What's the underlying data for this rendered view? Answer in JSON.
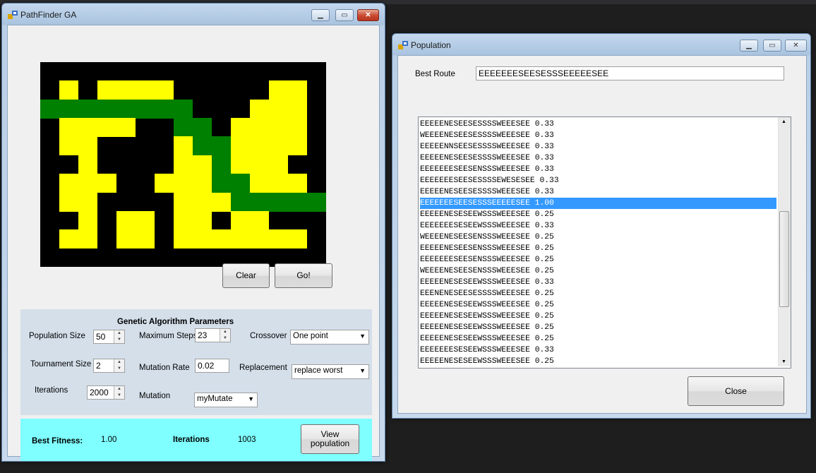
{
  "pathfinder": {
    "title": "PathFinder GA",
    "clear_label": "Clear",
    "go_label": "Go!",
    "params_heading": "Genetic Algorithm Parameters",
    "population_size_label": "Population Size",
    "population_size": "50",
    "max_steps_label": "Maximum Steps",
    "max_steps": "23",
    "crossover_label": "Crossover",
    "crossover": "One point",
    "tournament_size_label": "Tournament Size",
    "tournament_size": "2",
    "mutation_rate_label": "Mutation Rate",
    "mutation_rate": "0.02",
    "replacement_label": "Replacement",
    "replacement": "replace worst",
    "iterations_label": "Iterations",
    "iterations": "2000",
    "mutation_label": "Mutation",
    "mutation": "myMutate",
    "best_fitness_label": "Best Fitness:",
    "best_fitness": "1.00",
    "iterations_result_label": "Iterations",
    "iterations_result": "1003",
    "view_population_label": "View population"
  },
  "population": {
    "title": "Population",
    "best_route_label": "Best Route",
    "best_route": "EEEEEEESEESESSSEEEEESEE",
    "close_label": "Close",
    "rows": [
      "EEEEENESEESESSSSWEEESEE 0.33",
      "WEEEENESEESESSSSWEEESEE 0.33",
      "EEEEENNSEESESSSSWEEESEE 0.33",
      "EEEEENESEESESSSSWEEESEE 0.33",
      "EEEEEEESEESENSSSWEEESEE 0.33",
      "EEEEEEESEESESSSSEWESESEE 0.33",
      "EEEEENESEESESSSSWEEESEE 0.33",
      "EEEEEEESEESESSSEEEEESEE 1.00",
      "EEEEENESESEEWSSSWEEESEE 0.25",
      "EEEEEEESESEEWSSSWEEESEE 0.33",
      "WEEEENESEESENSSSWEEESEE 0.25",
      "EEEEENESEESENSSSWEEESEE 0.25",
      "EEEEEEESEESENSSSWEEESEE 0.25",
      "WEEEENESEESENSSSWEEESEE 0.25",
      "EEEEENESESEEWSSSWEEESEE 0.33",
      "EEENENESEESESSSSWEEESEE 0.25",
      "EEEEENESESEEWSSSWEEESEE 0.25",
      "EEEEENESESEEWSSSWEEESEE 0.25",
      "EEEEENESESEEWSSSWEEESEE 0.25",
      "EEEEENESESEEWSSSWEEESEE 0.25",
      "EEEEEEESESEEWSSSWEEESEE 0.33",
      "EEEEENESESEEWSSSWEEESEE 0.25"
    ],
    "selected_index": 7
  },
  "maze": {
    "wall_color": "#000000",
    "open_color": "#ffff00",
    "path_color": "#008000",
    "cells": [
      "000000000000000",
      "010111100000110",
      "222222220001110",
      "011110022011110",
      "011000012211110",
      "001000011211100",
      "011100111221110",
      "011000011122222",
      "001011011011000",
      "011011011111110",
      "000000000000000"
    ]
  }
}
